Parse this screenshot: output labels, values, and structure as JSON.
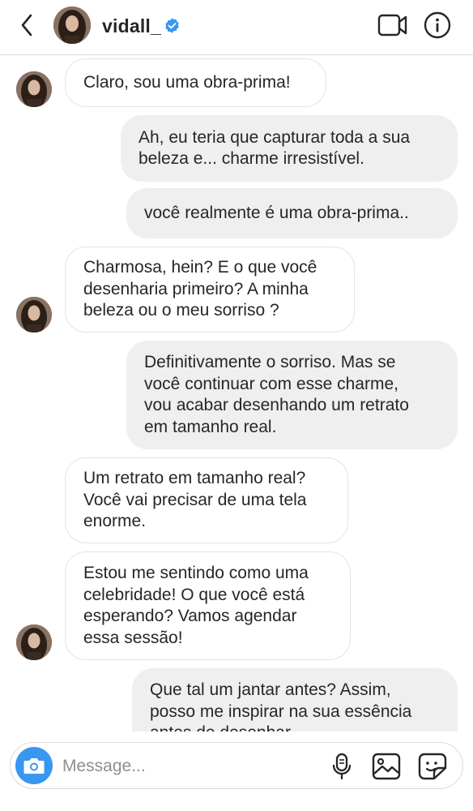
{
  "header": {
    "username": "vidall_"
  },
  "messages": [
    {
      "side": "in",
      "lines": [
        "Claro, sou uma obra-prima!"
      ]
    },
    {
      "side": "out",
      "lines": [
        "Ah, eu teria que capturar toda a sua",
        "beleza e... charme irresistível."
      ]
    },
    {
      "side": "out",
      "lines": [
        "você realmente é uma obra-prima.."
      ]
    },
    {
      "side": "in",
      "lines": [
        "Charmosa, hein? E o que você",
        "desenharia primeiro? A minha",
        "beleza ou o meu sorriso ?"
      ]
    },
    {
      "side": "out",
      "lines": [
        "Definitivamente o sorriso. Mas se",
        "você continuar com esse charme,",
        "vou acabar desenhando um retrato",
        "em tamanho real."
      ]
    },
    {
      "side": "in",
      "lines": [
        "Um retrato em tamanho real?",
        "Você vai precisar de uma tela",
        "enorme."
      ]
    },
    {
      "side": "in",
      "lines": [
        "Estou me sentindo como uma",
        "celebridade! O que você está",
        "esperando? Vamos agendar",
        "essa sessão!"
      ]
    },
    {
      "side": "out",
      "lines": [
        "Que tal um jantar antes? Assim,",
        "posso me inspirar na sua essência",
        "antes de desenhar."
      ]
    }
  ],
  "composer": {
    "placeholder": "Message..."
  },
  "icons": {
    "back": "chevron-left-icon",
    "verified": "verified-badge-icon",
    "video": "video-camera-icon",
    "info": "info-icon",
    "camera": "camera-icon",
    "mic": "microphone-icon",
    "gallery": "gallery-icon",
    "sticker": "sticker-icon"
  },
  "colors": {
    "accent": "#3897f0",
    "outgoing_bubble": "#efefef",
    "incoming_border": "#e3e3e3"
  }
}
